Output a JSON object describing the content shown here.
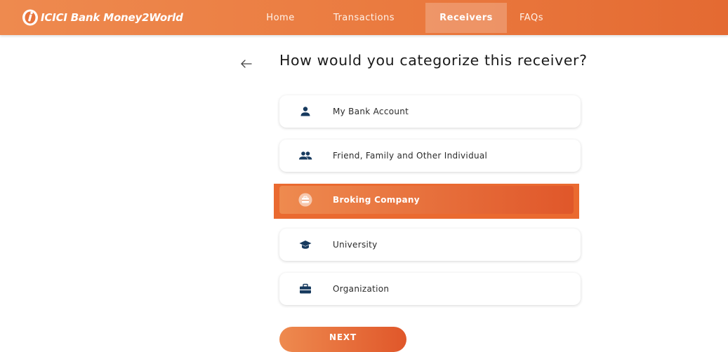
{
  "header": {
    "brand": "ICICI Bank Money2World",
    "nav": [
      {
        "label": "Home"
      },
      {
        "label": "Transactions"
      },
      {
        "label": "Receivers",
        "active": true
      },
      {
        "label": "FAQs"
      }
    ]
  },
  "main": {
    "title": "How would you categorize this receiver?",
    "options": [
      {
        "label": "My Bank Account",
        "icon": "person-icon"
      },
      {
        "label": "Friend, Family and Other Individual",
        "icon": "people-icon"
      },
      {
        "label": "Broking Company",
        "icon": "briefcase-icon",
        "selected": true
      },
      {
        "label": "University",
        "icon": "graduation-cap-icon"
      },
      {
        "label": "Organization",
        "icon": "briefcase-icon"
      }
    ],
    "next_label": "NEXT"
  },
  "colors": {
    "accent": "#e8743b",
    "accent_dark": "#e0572a",
    "icon_navy": "#173a5e"
  }
}
